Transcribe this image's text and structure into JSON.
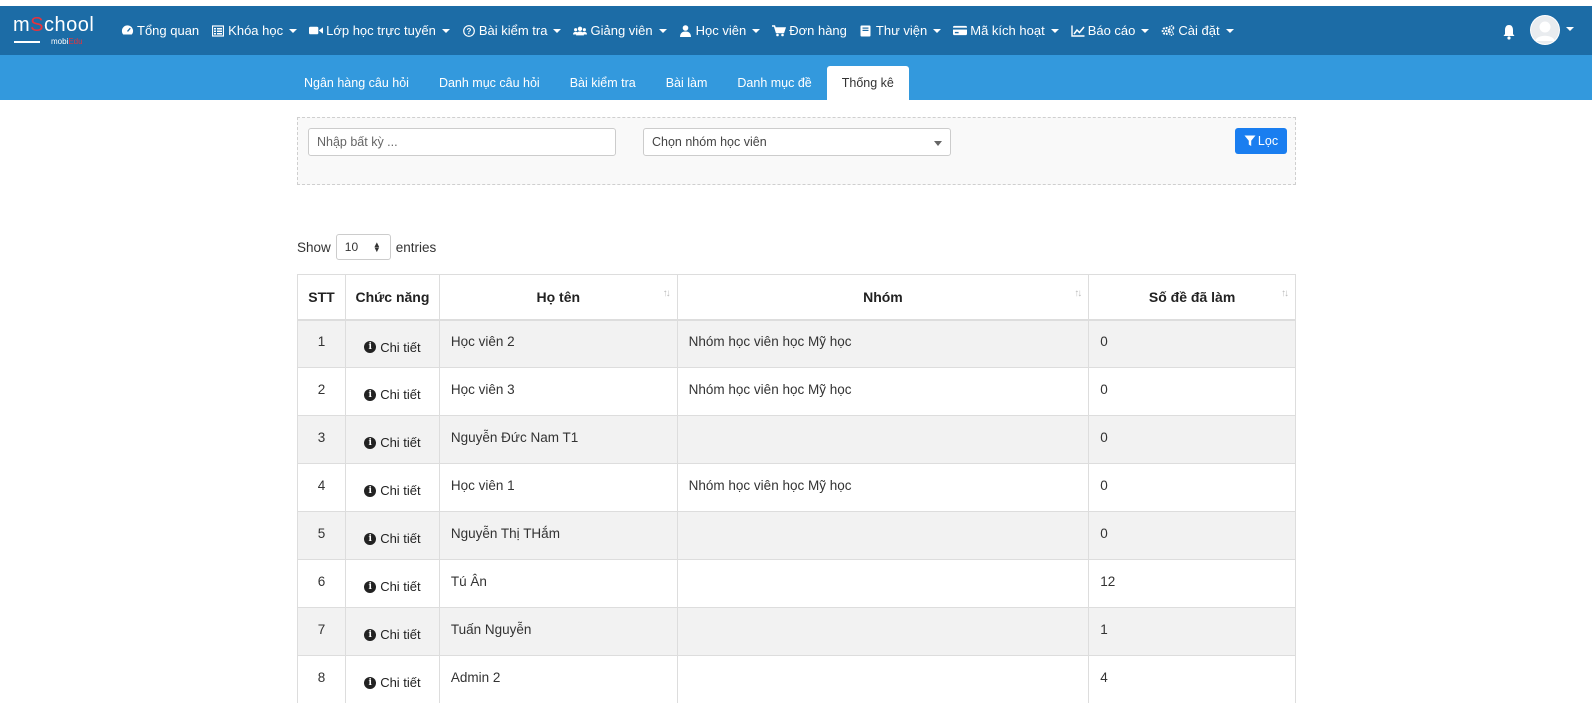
{
  "brand": {
    "logo_main_a": "m",
    "logo_main_b": "S",
    "logo_main_c": "chool",
    "logo_sub_a": "mobi",
    "logo_sub_b": "Edu"
  },
  "nav": {
    "items": [
      {
        "label": "Tổng quan",
        "icon": "dashboard-icon",
        "caret": false
      },
      {
        "label": "Khóa học",
        "icon": "list-icon",
        "caret": true
      },
      {
        "label": "Lớp học trực tuyến",
        "icon": "video-icon",
        "caret": true
      },
      {
        "label": "Bài kiểm tra",
        "icon": "question-icon",
        "caret": true
      },
      {
        "label": "Giảng viên",
        "icon": "users-icon",
        "caret": true
      },
      {
        "label": "Học viên",
        "icon": "user-icon",
        "caret": true
      },
      {
        "label": "Đơn hàng",
        "icon": "cart-icon",
        "caret": false
      },
      {
        "label": "Thư viện",
        "icon": "book-icon",
        "caret": true
      },
      {
        "label": "Mã kích hoạt",
        "icon": "card-icon",
        "caret": true
      },
      {
        "label": "Báo cáo",
        "icon": "chart-icon",
        "caret": true
      },
      {
        "label": "Cài đặt",
        "icon": "gears-icon",
        "caret": true
      }
    ]
  },
  "subnav": {
    "tabs": [
      {
        "label": "Ngân hàng câu hỏi",
        "active": false
      },
      {
        "label": "Danh mục câu hỏi",
        "active": false
      },
      {
        "label": "Bài kiểm tra",
        "active": false
      },
      {
        "label": "Bài làm",
        "active": false
      },
      {
        "label": "Danh mục đề",
        "active": false
      },
      {
        "label": "Thống kê",
        "active": true
      }
    ]
  },
  "filter": {
    "search_placeholder": "Nhập bất kỳ ...",
    "group_select_value": "Chọn nhóm học viên",
    "filter_button": "Lọc"
  },
  "entries": {
    "show_label": "Show",
    "value": "10",
    "entries_label": "entries"
  },
  "table": {
    "columns": [
      "STT",
      "Chức năng",
      "Họ tên",
      "Nhóm",
      "Số đề đã làm"
    ],
    "detail_label": "Chi tiết",
    "rows": [
      {
        "stt": "1",
        "name": "Học viên 2",
        "group": "Nhóm học viên học Mỹ học",
        "count": "0"
      },
      {
        "stt": "2",
        "name": "Học viên 3",
        "group": "Nhóm học viên học Mỹ học",
        "count": "0"
      },
      {
        "stt": "3",
        "name": "Nguyễn Đức Nam T1",
        "group": "",
        "count": "0"
      },
      {
        "stt": "4",
        "name": "Học viên 1",
        "group": "Nhóm học viên học Mỹ học",
        "count": "0"
      },
      {
        "stt": "5",
        "name": "Nguyễn Thị THắm",
        "group": "",
        "count": "0"
      },
      {
        "stt": "6",
        "name": "Tú Ân",
        "group": "",
        "count": "12"
      },
      {
        "stt": "7",
        "name": "Tuấn Nguyễn",
        "group": "",
        "count": "1"
      },
      {
        "stt": "8",
        "name": "Admin 2",
        "group": "",
        "count": "4"
      }
    ]
  },
  "colors": {
    "navbar": "#1c6ca6",
    "subnav": "#3399dd",
    "filter_button": "#1a7ef0"
  }
}
